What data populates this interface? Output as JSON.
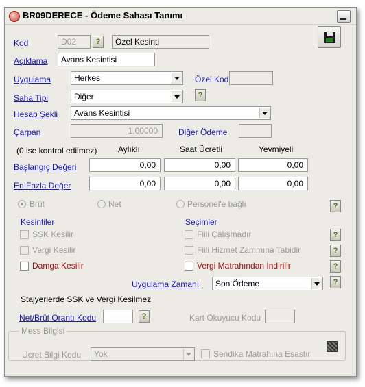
{
  "window": {
    "title": "BR09DERECE - Ödeme Sahası Tanımı"
  },
  "kod": {
    "label": "Kod",
    "code_value": "D02",
    "name_value": "Özel Kesinti"
  },
  "aciklama": {
    "label": "Açıklama",
    "value": "Avans Kesintisi"
  },
  "uygulama": {
    "label": "Uygulama",
    "value": "Herkes"
  },
  "ozel_kod": {
    "label": "Özel Kod",
    "value": ""
  },
  "saha_tipi": {
    "label": "Saha Tipi",
    "value": "Diğer"
  },
  "hesap_sekli": {
    "label": "Hesap Şekli",
    "value": "Avans Kesintisi"
  },
  "carpan": {
    "label": "Çarpan",
    "value": "1,00000"
  },
  "diger_odeme": {
    "label": "Diğer Ödeme",
    "value": ""
  },
  "columns": {
    "note": "(0 ise kontrol edilmez)",
    "aylikli": "Aylıklı",
    "saat_ucretli": "Saat Ücretli",
    "yevmiyeli": "Yevmiyeli"
  },
  "baslangic": {
    "label": "Başlangıç Değeri",
    "values": [
      "0,00",
      "0,00",
      "0,00"
    ]
  },
  "en_fazla": {
    "label": "En Fazla Değer",
    "values": [
      "0,00",
      "0,00",
      "0,00"
    ]
  },
  "radios": {
    "brut": "Brüt",
    "net": "Net",
    "personel": "Personel'e bağlı"
  },
  "kesintiler": {
    "title": "Kesintiler",
    "ssk": "SSK Kesilir",
    "vergi": "Vergi Kesilir",
    "damga": "Damga Kesilir"
  },
  "secimler": {
    "title": "Seçimler",
    "fiili_calisma": "Fiili Çalışmadır",
    "fiili_hizmet": "Fiili Hizmet Zammına Tabidir",
    "vergi_matrah": "Vergi Matrahından İndirilir"
  },
  "uygulama_zamani": {
    "label": "Uygulama Zamanı",
    "value": "Son Ödeme"
  },
  "stajyer_note": "Stajyerlerde SSK ve Vergi Kesilmez",
  "net_brut": {
    "label": "Net/Brüt Orantı Kodu",
    "value": ""
  },
  "kart_okuyucu": {
    "label": "Kart Okuyucu Kodu",
    "value": ""
  },
  "mess": {
    "title": "Mess Bilgisi",
    "ucret_label": "Ücret Bilgi Kodu",
    "ucret_value": "Yok",
    "sendika": "Sendika Matrahına Esastır"
  },
  "help_glyph": "?"
}
